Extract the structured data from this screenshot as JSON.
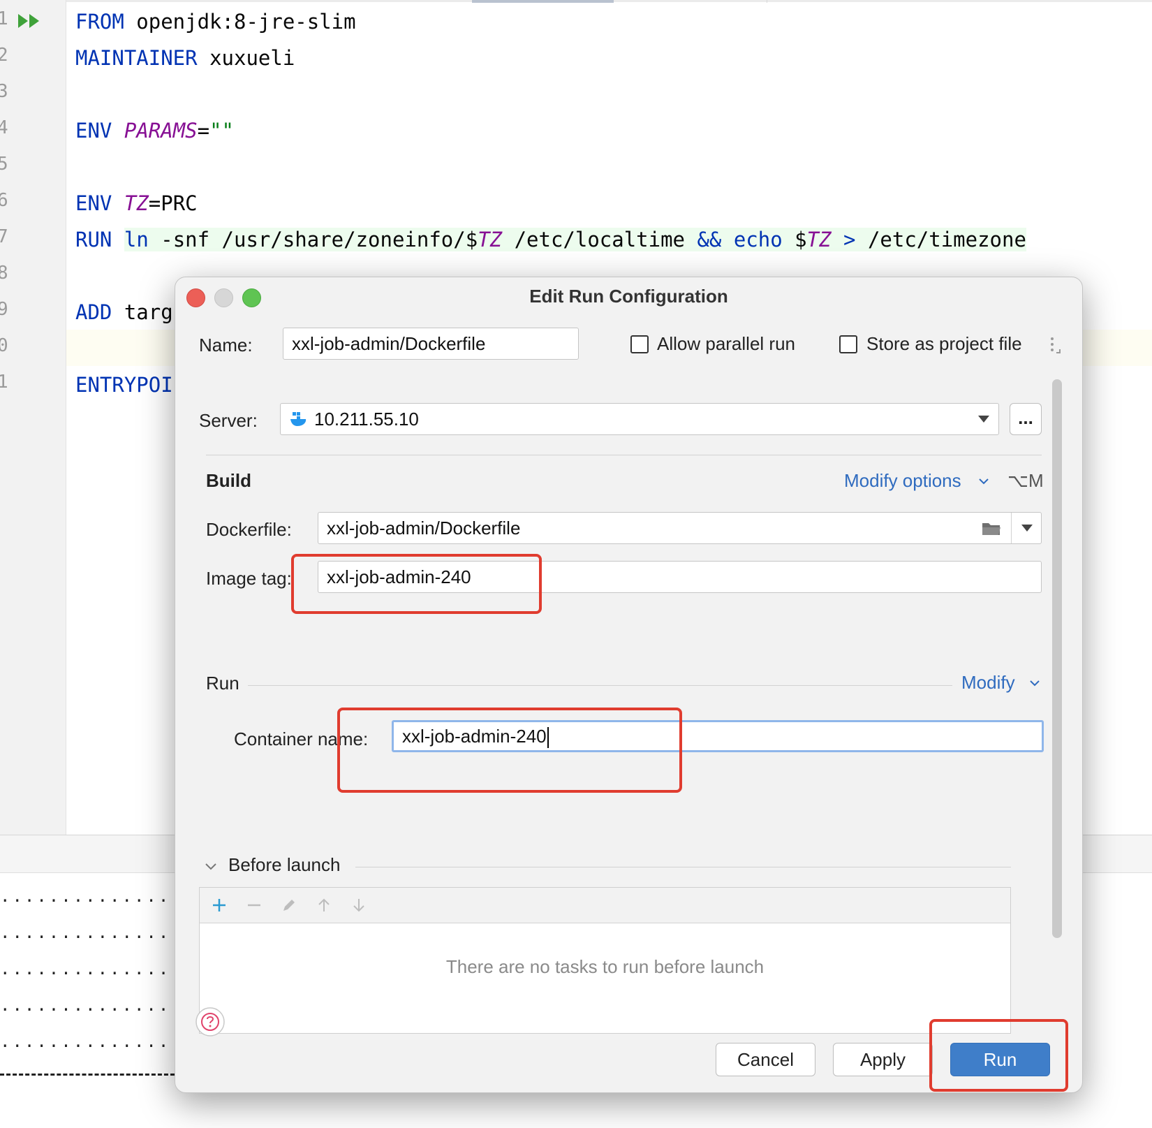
{
  "editor": {
    "gutter_numbers": [
      "1",
      "2",
      "3",
      "4",
      "5",
      "6",
      "7",
      "8",
      "9",
      "0",
      "1"
    ],
    "lines": {
      "l1": {
        "kw": "FROM",
        "rest": " openjdk:8-jre-slim"
      },
      "l2": {
        "kw": "MAINTAINER",
        "rest": " xuxueli"
      },
      "l4": {
        "kw": "ENV",
        "var": "PARAMS",
        "eq": "=",
        "str": "\"\""
      },
      "l6": {
        "kw": "ENV",
        "var": "TZ",
        "rest": "=PRC"
      },
      "l7": {
        "kw": "RUN",
        "t1": "ln",
        "t2": " -snf /usr/share/zoneinfo/$",
        "t3": "TZ",
        "t4": " /etc/localtime ",
        "t5": "&&",
        "t6": " ",
        "t7": "echo",
        "t8": " $",
        "t9": "TZ",
        "t10": " ",
        "t11": ">",
        "t12": " /etc/timezone"
      },
      "l9": {
        "kw": "ADD",
        "rest": " targ"
      },
      "l11": {
        "kw": "ENTRYPOI"
      }
    }
  },
  "bottom_panel": {
    "dots": "...................",
    "dash": "-------------"
  },
  "dialog": {
    "title": "Edit Run Configuration",
    "name_label": "Name:",
    "name_value": "xxl-job-admin/Dockerfile",
    "allow_parallel_label": "Allow parallel run",
    "store_project_label": "Store as project file",
    "server_label": "Server:",
    "server_value": "10.211.55.10",
    "server_more": "...",
    "build_title": "Build",
    "modify_options": "Modify options",
    "modify_options_shortcut": "⌥M",
    "dockerfile_label": "Dockerfile:",
    "dockerfile_value": "xxl-job-admin/Dockerfile",
    "image_tag_label": "Image tag:",
    "image_tag_value": "xxl-job-admin-240",
    "run_title": "Run",
    "modify": "Modify",
    "container_name_label": "Container name:",
    "container_name_value": "xxl-job-admin-240",
    "before_launch_title": "Before launch",
    "no_tasks_text": "There are no tasks to run before launch",
    "buttons": {
      "cancel": "Cancel",
      "apply": "Apply",
      "run": "Run"
    }
  },
  "colors": {
    "keyword": "#0033b3",
    "variable": "#871094",
    "string": "#067d17",
    "link": "#2f6bbf",
    "primary_button": "#3f7ec9",
    "highlight_box": "#e03c2f"
  },
  "icons": [
    "run-gutter-icon",
    "docker-icon",
    "dropdown-arrow-icon",
    "folder-icon",
    "chevron-down-icon",
    "collapse-chevron-icon",
    "add-icon",
    "remove-icon",
    "edit-icon",
    "move-up-icon",
    "move-down-icon",
    "help-icon",
    "drag-handle-icon"
  ]
}
